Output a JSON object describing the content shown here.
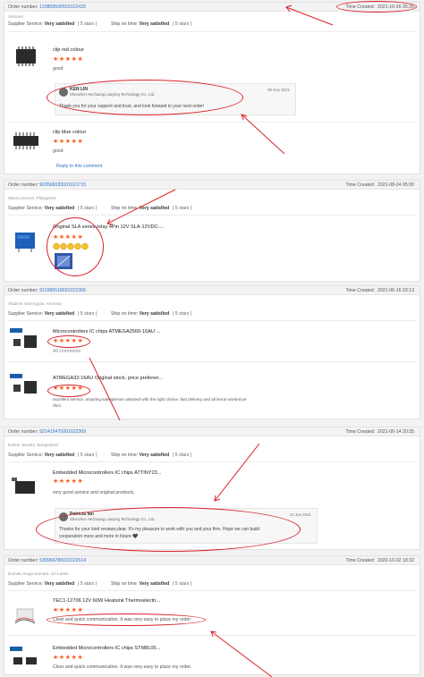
{
  "common": {
    "order_label": "Order number:",
    "time_label": "Time Created:",
    "supplier_label": "Supplier Service:",
    "ship_label": "Ship on time:",
    "vs": "Very satisfied",
    "five": "( 5 stars )",
    "stars": "★★★★★"
  },
  "o1": {
    "num": "110809506501022433",
    "time": "2021-10-26 05:26",
    "loc": "Vietnam",
    "p1_title": "clip red colour",
    "p1_comment": "good",
    "reply_name": "KEN LIN",
    "reply_company": "Shenzhen Hechuang Lianying Technology Co., Ltd.",
    "reply_date": "09 Nov 2021",
    "reply_text": "Thank you for your support and trust, and look forward to your next order!",
    "p2_title": "clip blue colour",
    "p2_comment": "good",
    "reply_link": "Reply to this comment"
  },
  "o2": {
    "num": "903568183001021715",
    "time": "2021-08-24 05:00",
    "loc": "Manny Esonei, Philippines",
    "p1_title": "Original SLA series relay 4Pin 12V SLA-12VDC-..."
  },
  "o3": {
    "num": "911086518031022309",
    "time": "2021-06-16 03:13",
    "loc": "Vladimir Gevorgyan, Armenia",
    "p1_title": "Microcontrollers IC chips ATMEGA2560-16AU ...",
    "p1_comment": "All comments",
    "p2_title": "ATMEGA32-16AU Original stock, price preferen...",
    "p2_comment": "excellent service. amazing salesperson assisted with the right choice. fast delivery and all items worked pe",
    "p2_comment2": "rfect."
  },
  "o4": {
    "num": "921415475001022309",
    "time": "2021-06-14 20:35",
    "loc": "kesbin Jewelry, Bangladesh",
    "p1_title": "Embedded Microcontrollers IC chips ATTINY23...",
    "p1_comment": "very good service and original products.",
    "reply_name": "Petricia fan",
    "reply_company": "Shenzhen Hechuang Lianying Technology Co., Ltd.",
    "reply_date": "23 Jun 2021",
    "reply_text": "Thanks for your kind reviews,dear. It's my pleasure to work with you and your firm. Hope we can build",
    "reply_text2": "cooperation more and more in future 🖤"
  },
  "o5": {
    "num": "539966780031022614",
    "time": "2020-10-02 18:32",
    "loc": "Dumidu Nuga Kumara, Sri Lanka",
    "p1_title": "TEC1-12706 12V 60W Heatsink Thermoelectri...",
    "p1_comment": "Clear and quick communication. It was very easy to place my order.",
    "p2_title": "Embedded Microcontrollers IC chips STM8L05...",
    "p2_comment": "Clear and quick communication. It was very easy to place my order."
  }
}
